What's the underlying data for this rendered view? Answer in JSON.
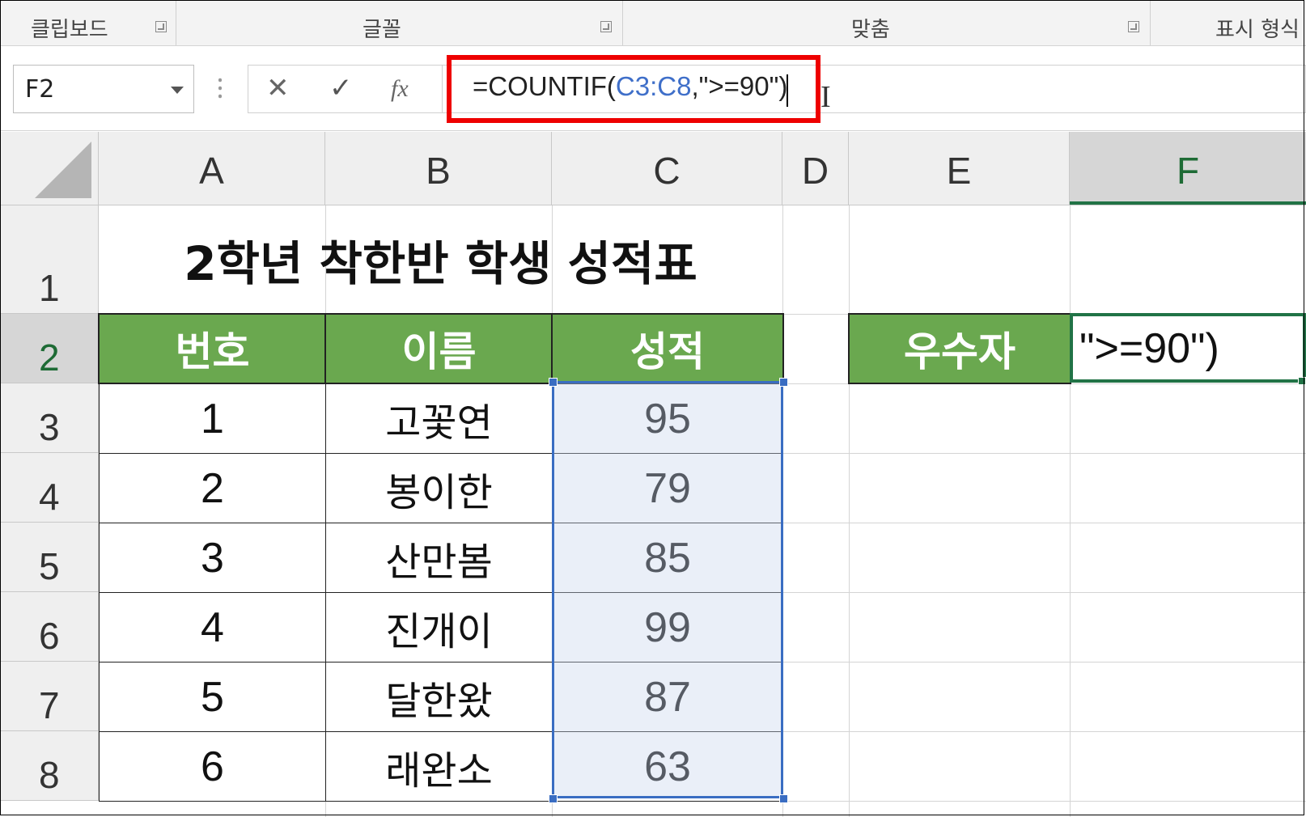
{
  "ribbon": {
    "groups": [
      {
        "label": "클립보드"
      },
      {
        "label": "글꼴"
      },
      {
        "label": "맞춤"
      },
      {
        "label": "표시 형식"
      }
    ]
  },
  "formula_bar": {
    "name_box": "F2",
    "cancel_icon": "✕",
    "enter_icon": "✓",
    "fx_label": "fx",
    "formula_prefix": "=COUNTIF(",
    "formula_ref": "C3:C8",
    "formula_suffix": ",\">=90\")"
  },
  "columns": [
    "A",
    "B",
    "C",
    "D",
    "E",
    "F"
  ],
  "selected_column": "F",
  "rows": [
    "1",
    "2",
    "3",
    "4",
    "5",
    "6",
    "7",
    "8"
  ],
  "selected_row": "2",
  "sheet": {
    "title": "2학년 착한반 학생 성적표",
    "headers": [
      "번호",
      "이름",
      "성적"
    ],
    "records": [
      {
        "no": "1",
        "name": "고꽃연",
        "score": "95"
      },
      {
        "no": "2",
        "name": "봉이한",
        "score": "79"
      },
      {
        "no": "3",
        "name": "산만봄",
        "score": "85"
      },
      {
        "no": "4",
        "name": "진개이",
        "score": "99"
      },
      {
        "no": "5",
        "name": "달한왔",
        "score": "87"
      },
      {
        "no": "6",
        "name": "래완소",
        "score": "63"
      }
    ],
    "label_cell": "우수자",
    "active_cell_text": "\">=90\")"
  },
  "colors": {
    "header_fill": "#6aa84f",
    "selection_border": "#3a6dc2",
    "active_border": "#217346",
    "highlight_box": "#ee0000"
  }
}
